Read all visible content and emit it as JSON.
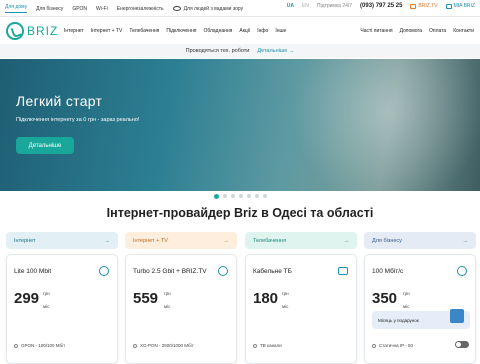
{
  "topbar": {
    "links": [
      "Для дому",
      "Для бізнесу",
      "GPON",
      "Wi-Fi",
      "Енергонезалежність"
    ],
    "accessibility": "Для людей з вадами зору",
    "lang_active": "UA",
    "lang_other": "EN",
    "support": "Підтримка 24/7",
    "phone": "(093) 797 25 25",
    "tv": "BRIZ.TV",
    "mia": "MIA BRIZ"
  },
  "header": {
    "logo": "BRIZ",
    "nav_left": [
      "Інтернет",
      "Інтернет + TV",
      "Телебачення",
      "Підключення",
      "Обладнання",
      "Акції",
      "Інфо",
      "Інше"
    ],
    "nav_right": [
      "Часті питання",
      "Допомога",
      "Оплата",
      "Контакти"
    ]
  },
  "notice": {
    "text": "Проводяться тех. роботи",
    "link": "Детальніше →"
  },
  "hero": {
    "title": "Легкий старт",
    "subtitle": "Підключення інтернету за 0 грн - зараз реально!",
    "button": "Детальніше"
  },
  "section_title": "Інтернет-провайдер Briz в Одесі та області",
  "categories": [
    {
      "label": "Інтернет",
      "arrow": "→"
    },
    {
      "label": "Інтернет + TV",
      "arrow": "→"
    },
    {
      "label": "Телебачення",
      "arrow": "→"
    },
    {
      "label": "Для бізнесу",
      "arrow": "→"
    }
  ],
  "plans": [
    {
      "name": "Lite 100 Mbit",
      "price": "299",
      "currency": "грн",
      "period": "міс",
      "feature": "GPON - 100/100 Мбіт"
    },
    {
      "name": "Turbo 2.5 Gbit + BRIZ.TV",
      "price": "559",
      "currency": "грн",
      "period": "міс",
      "feature": "XG-PON - 2500/1000 Мбіт"
    },
    {
      "name": "Кабельне ТБ",
      "price": "180",
      "currency": "грн",
      "period": "міс",
      "feature": "ТВ канали"
    },
    {
      "name": "100 Мбіт/с",
      "price": "350",
      "currency": "грн",
      "period": "міс",
      "gift": "Місяць у подарунок",
      "feature": "Статична IP - 50"
    }
  ]
}
